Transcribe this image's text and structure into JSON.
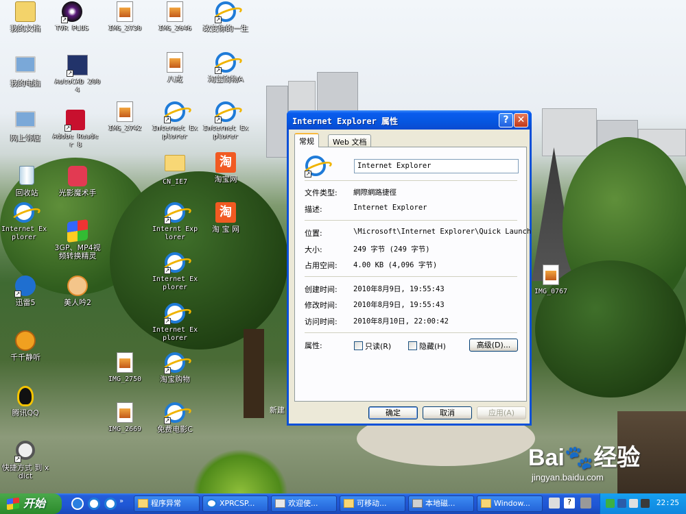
{
  "desktop": {
    "icons": [
      {
        "label": "我的文档",
        "icon": "documents-folder-icon"
      },
      {
        "label": "TVR PLUS",
        "icon": "tvr-plus-icon"
      },
      {
        "label": "IMG_2730",
        "icon": "image-file-icon"
      },
      {
        "label": "IMG_2646",
        "icon": "image-file-icon"
      },
      {
        "label": "改变你的一生",
        "icon": "internet-explorer-icon"
      },
      {
        "label": "我的电脑",
        "icon": "my-computer-icon"
      },
      {
        "label": "AutoCAD 2004",
        "icon": "autocad-icon"
      },
      {
        "label": "八戒",
        "icon": "image-file-icon"
      },
      {
        "label": "淘宝购物A",
        "icon": "internet-explorer-icon"
      },
      {
        "label": "网上邻居",
        "icon": "network-places-icon"
      },
      {
        "label": "Adobe Reader 8",
        "icon": "adobe-reader-icon"
      },
      {
        "label": "IMG_2742",
        "icon": "image-file-icon"
      },
      {
        "label": "Internet Explorer",
        "icon": "internet-explorer-icon"
      },
      {
        "label": "Internet Explorer",
        "icon": "internet-explorer-icon"
      },
      {
        "label": "回收站",
        "icon": "recycle-bin-icon"
      },
      {
        "label": "光影魔术手",
        "icon": "photo-editor-icon"
      },
      {
        "label": "CN_IE7",
        "icon": "folder-icon"
      },
      {
        "label": "淘宝网",
        "icon": "taobao-icon"
      },
      {
        "label": "Internet Explorer",
        "icon": "internet-explorer-icon"
      },
      {
        "label": "3GP、MP4视频转换精灵",
        "icon": "video-converter-icon"
      },
      {
        "label": "Internt Explorer",
        "icon": "internet-explorer-icon"
      },
      {
        "label": "淘 宝 网",
        "icon": "taobao-icon"
      },
      {
        "label": "Internet Explorer",
        "icon": "internet-explorer-icon"
      },
      {
        "label": "迅雷5",
        "icon": "thunder-icon"
      },
      {
        "label": "美人吟2",
        "icon": "game-icon"
      },
      {
        "label": "Internet Explorer",
        "icon": "internet-explorer-icon"
      },
      {
        "label": "千千静听",
        "icon": "music-player-icon"
      },
      {
        "label": "IMG_2750",
        "icon": "image-file-icon"
      },
      {
        "label": "淘宝购物",
        "icon": "internet-explorer-icon"
      },
      {
        "label": "腾讯QQ",
        "icon": "qq-icon"
      },
      {
        "label": "IMG_2669",
        "icon": "image-file-icon"
      },
      {
        "label": "免费电影C",
        "icon": "internet-explorer-icon"
      },
      {
        "label": "快捷方式 到 xdict",
        "icon": "dictionary-icon"
      },
      {
        "label": "IMG_0767",
        "icon": "image-file-icon"
      }
    ],
    "partial_label": "新建"
  },
  "dialog": {
    "title": "Internet Explorer 属性",
    "help_button": "?",
    "close_button": "✕",
    "tabs": [
      "常规",
      "Web 文档"
    ],
    "name_value": "Internet Explorer",
    "fields": {
      "file_type_label": "文件类型:",
      "file_type_value": "網際網路捷徑",
      "description_label": "描述:",
      "description_value": "Internet Explorer",
      "location_label": "位置:",
      "location_value": "\\Microsoft\\Internet Explorer\\Quick Launch",
      "size_label": "大小:",
      "size_value": "249 字节 (249 字节)",
      "disk_size_label": "占用空间:",
      "disk_size_value": "4.00 KB (4,096 字节)",
      "created_label": "创建时间:",
      "created_value": "2010年8月9日, 19:55:43",
      "modified_label": "修改时间:",
      "modified_value": "2010年8月9日, 19:55:43",
      "accessed_label": "访问时间:",
      "accessed_value": "2010年8月10日, 22:00:42",
      "attributes_label": "属性:"
    },
    "attributes": {
      "readonly": "只读(R)",
      "hidden": "隐藏(H)",
      "advanced": "高级(D)..."
    },
    "buttons": {
      "ok": "确定",
      "cancel": "取消",
      "apply": "应用(A)"
    }
  },
  "taskbar": {
    "start": "开始",
    "tasks": [
      "程序异常",
      "XPRCSP...",
      "欢迎使...",
      "可移动...",
      "本地磁...",
      "Window..."
    ],
    "clock": "22:25"
  },
  "watermark": {
    "logo": "Bai🐾经验",
    "url": "jingyan.baidu.com"
  }
}
